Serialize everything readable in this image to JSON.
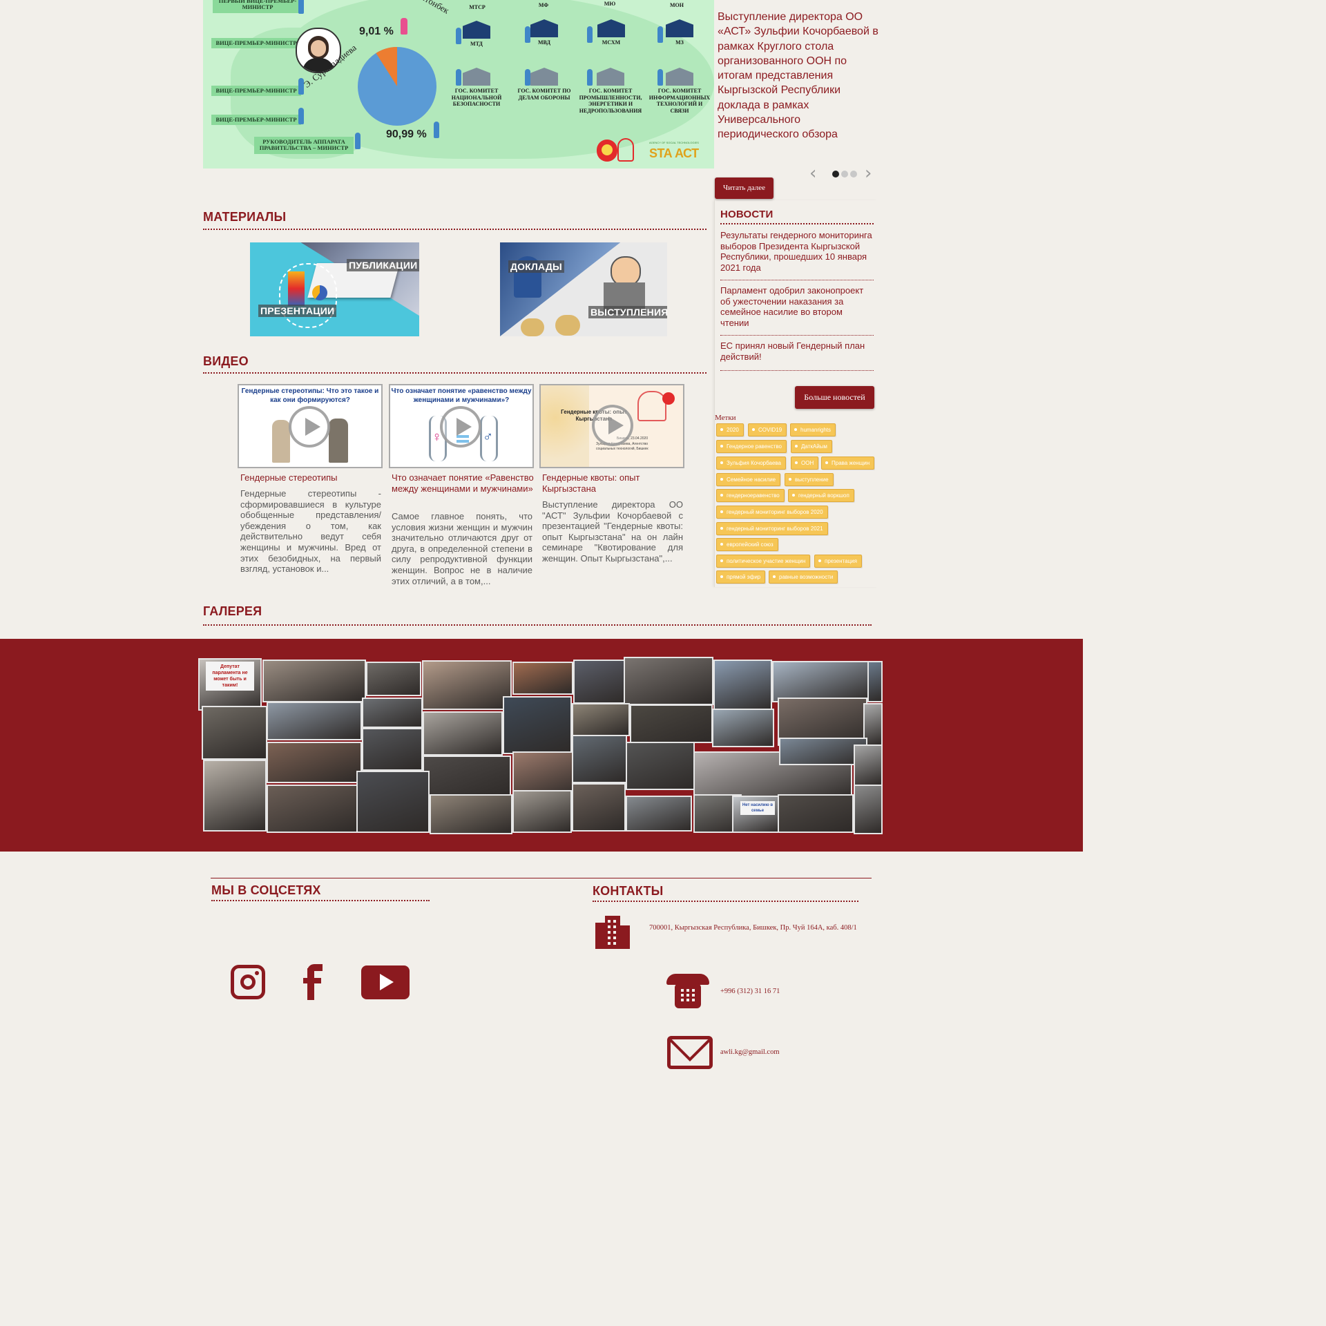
{
  "hero": {
    "infographic": {
      "labels_left": [
        "ПЕРВЫЙ ВИЦЕ-ПРЕМЬЕР-МИНИСТР",
        "ВИЦЕ-ПРЕМЬЕР-МИНИСТР",
        "ВИЦЕ-ПРЕМЬЕР-МИНИСТР",
        "ВИЦЕ-ПРЕМЬЕР-МИНИСТР",
        "РУКОВОДИТЕЛЬ АППАРАТА ПРАВИТЕЛЬСТВА – МИНИСТР"
      ],
      "map_names": [
        "Солтонбек",
        "Э. Сурабалдиева"
      ],
      "pie_women_pct": "9,01 %",
      "pie_men_pct": "90,99 %",
      "pie_women_value": 9.01,
      "pie_men_value": 90.99,
      "ministries_row0": [
        "МТСР",
        "МФ",
        "МЮ",
        "МОН"
      ],
      "ministries_row1": [
        "МТД",
        "МВД",
        "МСХМ",
        "МЗ"
      ],
      "committees": [
        "ГОС. КОМИТЕТ НАЦИОНАЛЬНОЙ БЕЗОПАСНОСТИ",
        "ГОС. КОМИТЕТ ПО ДЕЛАМ ОБОРОНЫ",
        "ГОС. КОМИТЕТ ПРОМЫШЛЕННОСТИ, ЭНЕРГЕТИКИ И НЕДРОПОЛЬЗОВАНИЯ",
        "ГОС. КОМИТЕТ ИНФОРМАЦИОННЫХ ТЕХНОЛОГИЙ И СВЯЗИ"
      ],
      "logo_text": "STA АСТ",
      "logo_sub": "AGENCY OF SOCIAL TECHNOLOGIES",
      "colors": {
        "background": "#c9f2cf",
        "pie_men": "#5b9bd5",
        "pie_women": "#ed7d31"
      }
    },
    "text": "Выступление директора ОО «АСТ» Зульфии Кочорбаевой в рамках Круглого стола организованного ООН по итогам представления Кыргызской Республики доклада в рамках Универсального периодического обзора",
    "prev_icon": "chevron-left-icon",
    "next_icon": "chevron-right-icon",
    "read_more": "Читать далее"
  },
  "materials": {
    "title": "МАТЕРИАЛЫ",
    "card1": {
      "top_label": "ПУБЛИКАЦИИ",
      "bottom_label": "ПРЕЗЕНТАЦИИ"
    },
    "card2": {
      "top_label": "ДОКЛАДЫ",
      "bottom_label": "ВЫСТУПЛЕНИЯ"
    }
  },
  "news": {
    "title": "НОВОСТИ",
    "items": [
      "Результаты гендерного мониторинга выборов Президента Кыргызской Республики, прошедших 10 января 2021 года",
      "Парламент одобрил законопроект об ужесточении наказания за семейное насилие во втором чтении",
      "ЕС принял новый Гендерный план действий!"
    ],
    "more_button": "Больше новостей"
  },
  "tags": {
    "title": "Метки",
    "items": [
      "2020",
      "COVID19",
      "humanrights",
      "Гендерное равенство",
      "ДаткАйым",
      "Зульфия Кочорбаева",
      "ООН",
      "Права женщин",
      "Семейное насилие",
      "выступление",
      "гендерноеравенство",
      "гендерный воркшоп",
      "гендерный мониторинг выборов 2020",
      "гендерный мониторинг выборов 2021",
      "европейский союз",
      "политическое участие женщин",
      "презентация",
      "прямой эфир",
      "равные возможности"
    ]
  },
  "video": {
    "title": "ВИДЕО",
    "items": [
      {
        "thumb_text": "Гендерные стереотипы: Что это такое и как они формируются?",
        "title": "Гендерные стереотипы",
        "desc": "Гендерные стереотипы - сформировавшиеся в культуре обобщенные представления/убеждения о том, как действительно ведут себя женщины и мужчины. Вред от этих безобидных, на первый взгляд, установок и..."
      },
      {
        "thumb_text": "Что означает понятие «равенство между женщинами и мужчинами»?",
        "title": "Что означает понятие «Равенство между женщинами и мужчинами»",
        "desc": "Самое главное понять, что условия жизни женщин и мужчин значительно отличаются друг от друга, в определенной степени в силу репродуктивной функции женщин. Вопрос не в наличие этих отличий, а в том,..."
      },
      {
        "thumb_text": "Гендерные квоты: опыт Кыргызстана",
        "thumb_sub": "Зульфия Кочорбаева, Агентство социальных технологий, Бишкек",
        "thumb_date": "Бишкек, 23.04.2020",
        "title": "Гендерные квоты: опыт Кыргызстана",
        "desc": "Выступление директора ОО \"АСТ\" Зульфии Кочорбаевой с презентацией \"Гендерные квоты: опыт Кыргызстана\" на он лайн семинаре \"Квотирование для женщин. Опыт Кыргызстана\",..."
      }
    ]
  },
  "gallery": {
    "title": "ГАЛЕРЕЯ",
    "band_color": "#8b1a1f",
    "photo_captions": [
      "Депутат парламента не может быть и таким!",
      "Нет насилию в семье"
    ]
  },
  "footer": {
    "social_title": "МЫ В СОЦСЕТЯХ",
    "social_icons": [
      "instagram-icon",
      "facebook-icon",
      "youtube-icon"
    ],
    "contacts_title": "КОНТАКТЫ",
    "address": "700001, Кыргызская Республика, Бишкек, Пр. Чуй 164А, каб. 408/1",
    "phone": "+996 (312) 31 16 71",
    "email": "awli.kg@gmail.com",
    "contact_icons": [
      "building-icon",
      "phone-icon",
      "mail-icon"
    ]
  }
}
